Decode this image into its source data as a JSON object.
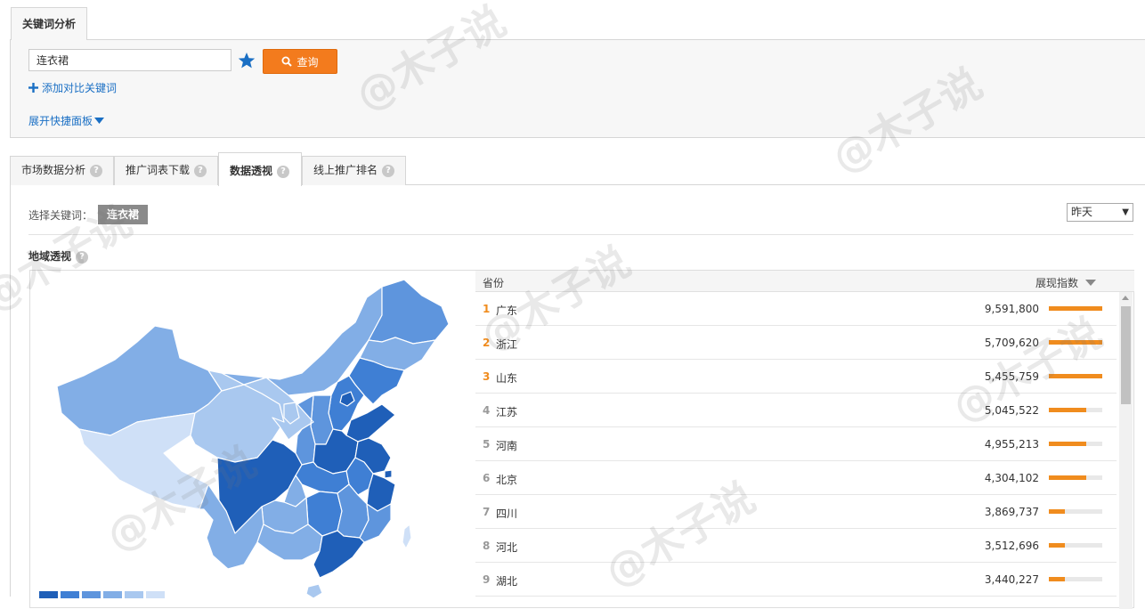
{
  "header": {
    "main_tab": "关键词分析"
  },
  "search": {
    "keyword_value": "连衣裙",
    "query_button": "查询",
    "add_compare": "添加对比关键词",
    "expand_panel": "展开快捷面板"
  },
  "sub_tabs": [
    {
      "label": "市场数据分析",
      "active": false
    },
    {
      "label": "推广词表下载",
      "active": false
    },
    {
      "label": "数据透视",
      "active": true
    },
    {
      "label": "线上推广排名",
      "active": false
    }
  ],
  "selection": {
    "label": "选择关键词：",
    "chip": "连衣裙",
    "date_value": "昨天"
  },
  "geo": {
    "title": "地域透视",
    "legend_colors": [
      "#1f5fb8",
      "#3f7fd4",
      "#5e95dd",
      "#82aee6",
      "#a9c8ef",
      "#cfe0f7"
    ]
  },
  "table": {
    "col_province": "省份",
    "col_index": "展现指数",
    "rows": [
      {
        "rank": "1",
        "province": "广东",
        "value": "9,591,800",
        "fill": 1.0
      },
      {
        "rank": "2",
        "province": "浙江",
        "value": "5,709,620",
        "fill": 1.0
      },
      {
        "rank": "3",
        "province": "山东",
        "value": "5,455,759",
        "fill": 1.0
      },
      {
        "rank": "4",
        "province": "江苏",
        "value": "5,045,522",
        "fill": 0.7
      },
      {
        "rank": "5",
        "province": "河南",
        "value": "4,955,213",
        "fill": 0.7
      },
      {
        "rank": "6",
        "province": "北京",
        "value": "4,304,102",
        "fill": 0.7
      },
      {
        "rank": "7",
        "province": "四川",
        "value": "3,869,737",
        "fill": 0.3
      },
      {
        "rank": "8",
        "province": "河北",
        "value": "3,512,696",
        "fill": 0.3
      },
      {
        "rank": "9",
        "province": "湖北",
        "value": "3,440,227",
        "fill": 0.3
      }
    ]
  },
  "watermark": "@木子说"
}
